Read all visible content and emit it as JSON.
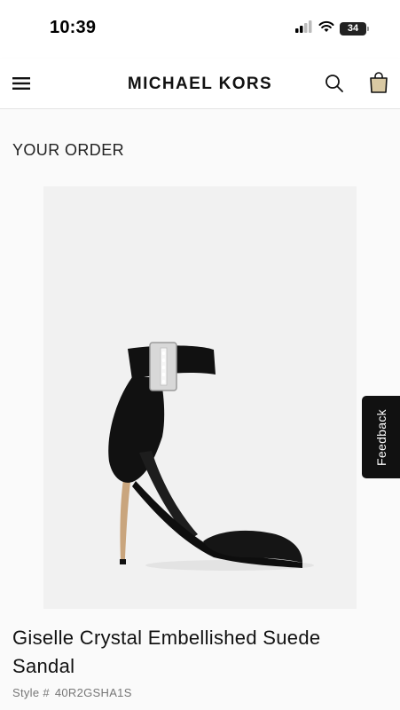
{
  "status_bar": {
    "time": "10:39",
    "battery": "34",
    "signal_icon": "cellular-signal-icon",
    "wifi_icon": "wifi-icon",
    "battery_icon": "battery-icon"
  },
  "header": {
    "brand": "MICHAEL KORS",
    "menu_icon": "hamburger-menu-icon",
    "search_icon": "search-icon",
    "bag_icon": "shopping-bag-icon"
  },
  "order": {
    "section_title": "YOUR ORDER",
    "product": {
      "name": "Giselle Crystal Embellished Suede Sandal",
      "style_label": "Style #",
      "style_value": "40R2GSHA1S"
    }
  },
  "feedback": {
    "label": "Feedback"
  },
  "colors": {
    "background": "#ffffff",
    "content_background": "#fafafa",
    "image_background": "#f1f1f1",
    "feedback_tab": "#111111",
    "text_primary": "#111111",
    "text_secondary": "#777777"
  }
}
